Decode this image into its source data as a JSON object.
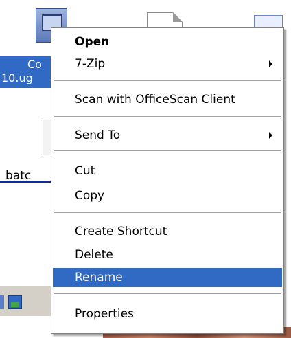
{
  "desktop": {
    "selected_label_line1": "Co",
    "selected_label_line2": "10.ug",
    "partial_label": "batc"
  },
  "menu": {
    "items": [
      {
        "label": "Open",
        "bold": true
      },
      {
        "label": "7-Zip",
        "submenu": true
      },
      {
        "label": "Scan with OfficeScan Client"
      },
      {
        "label": "Send To",
        "submenu": true
      },
      {
        "label": "Cut"
      },
      {
        "label": "Copy"
      },
      {
        "label": "Create Shortcut"
      },
      {
        "label": "Delete"
      },
      {
        "label": "Rename",
        "highlighted": true
      },
      {
        "label": "Properties"
      }
    ]
  },
  "colors": {
    "highlight": "#316ac5",
    "highlight_text": "#ffffff",
    "separator": "#a0a0a0"
  },
  "icons": [
    "document-icon",
    "chevron-right-icon",
    "network-icon"
  ]
}
